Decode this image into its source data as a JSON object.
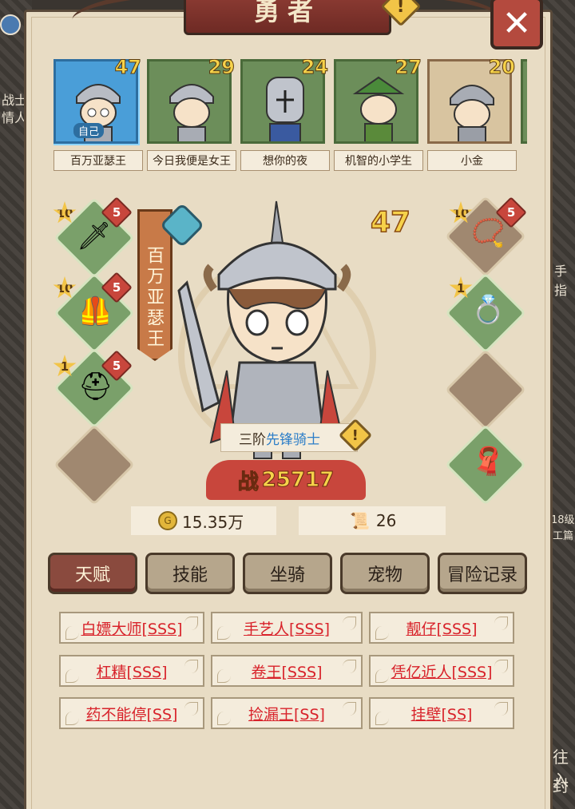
{
  "window": {
    "title": "勇者",
    "close_icon": "close-icon"
  },
  "side_text": {
    "left_top": "战士",
    "left_mid": "情人",
    "right_top": "手",
    "right_mid": "指",
    "right_low": "18级",
    "right_low2": "工篇",
    "right_bottom": "往入",
    "right_bottom2": "封"
  },
  "roster": [
    {
      "name": "百万亚瑟王",
      "level": "47",
      "tag": "自己",
      "selected": true
    },
    {
      "name": "今日我便是女王",
      "level": "29"
    },
    {
      "name": "想你的夜",
      "level": "24"
    },
    {
      "name": "机智的小学生",
      "level": "27"
    },
    {
      "name": "小金",
      "level": "20"
    }
  ],
  "hero": {
    "name": "百万亚瑟王",
    "level": "47",
    "rank": "三阶",
    "class": "先锋骑士",
    "power_label": "战",
    "power": "25717"
  },
  "equipment_left": [
    {
      "icon": "spear-icon",
      "star": "10",
      "plus": "5"
    },
    {
      "icon": "armor-icon",
      "star": "10",
      "plus": "5"
    },
    {
      "icon": "helmet-icon",
      "star": "1",
      "plus": "5"
    },
    {
      "icon": "empty-slot"
    }
  ],
  "equipment_right": [
    {
      "icon": "necklace-icon",
      "star": "10",
      "plus": "5"
    },
    {
      "icon": "ring-icon",
      "star": "1"
    },
    {
      "icon": "empty-slot"
    },
    {
      "icon": "cape-icon"
    }
  ],
  "resources": {
    "gold": "15.35万",
    "scroll": "26"
  },
  "tabs": [
    "天赋",
    "技能",
    "坐骑",
    "宠物",
    "冒险记录"
  ],
  "active_tab": "天赋",
  "talents": [
    "白嫖大师[SSS]",
    "手艺人[SSS]",
    "靓仔[SSS]",
    "杠精[SSS]",
    "卷王[SSS]",
    "凭亿近人[SSS]",
    "药不能停[SS]",
    "捡漏王[SS]",
    "挂壁[SS]"
  ],
  "colors": {
    "parchment": "#e8dcc4",
    "title_red": "#8a3a32",
    "talent_red": "#d8222a",
    "class_blue": "#2d7ec8",
    "level_gold": "#f6d24a"
  }
}
